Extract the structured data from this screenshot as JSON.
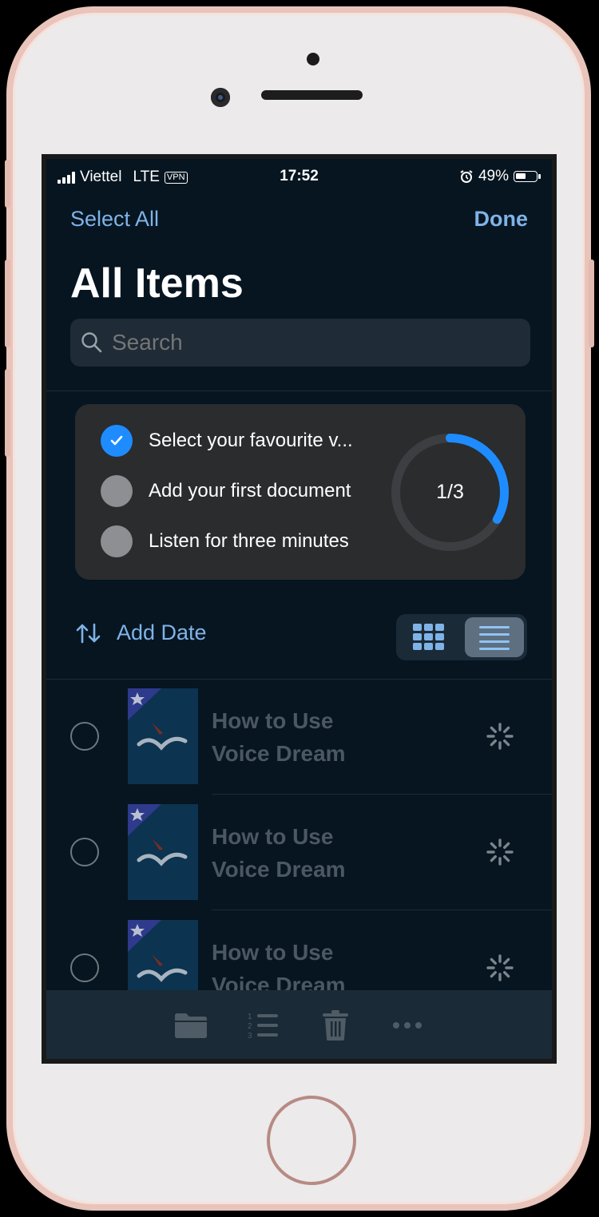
{
  "status_bar": {
    "carrier": "Viettel",
    "network": "LTE",
    "vpn": "VPN",
    "time": "17:52",
    "battery": "49%"
  },
  "nav": {
    "select_all": "Select All",
    "done": "Done",
    "title": "All Items"
  },
  "search": {
    "placeholder": "Search"
  },
  "onboarding": {
    "tasks": [
      {
        "label": "Select your favourite v...",
        "done": true
      },
      {
        "label": "Add your first document",
        "done": false
      },
      {
        "label": "Listen for three minutes",
        "done": false
      }
    ],
    "progress_text": "1/3",
    "progress_fraction": 0.333
  },
  "sort": {
    "label": "Add Date"
  },
  "view_mode": "list",
  "items": [
    {
      "title_line1": "How to Use",
      "title_line2": "Voice Dream"
    },
    {
      "title_line1": "How to Use",
      "title_line2": "Voice Dream"
    },
    {
      "title_line1": "How to Use",
      "title_line2": "Voice Dream"
    }
  ],
  "tab_bar": {
    "icons": [
      "folder-icon",
      "numbered-list-icon",
      "trash-icon",
      "more-icon"
    ]
  },
  "colors": {
    "accent": "#7fb3e8",
    "progress": "#1e8cff",
    "background": "#061520",
    "card": "#2a2c2e"
  }
}
